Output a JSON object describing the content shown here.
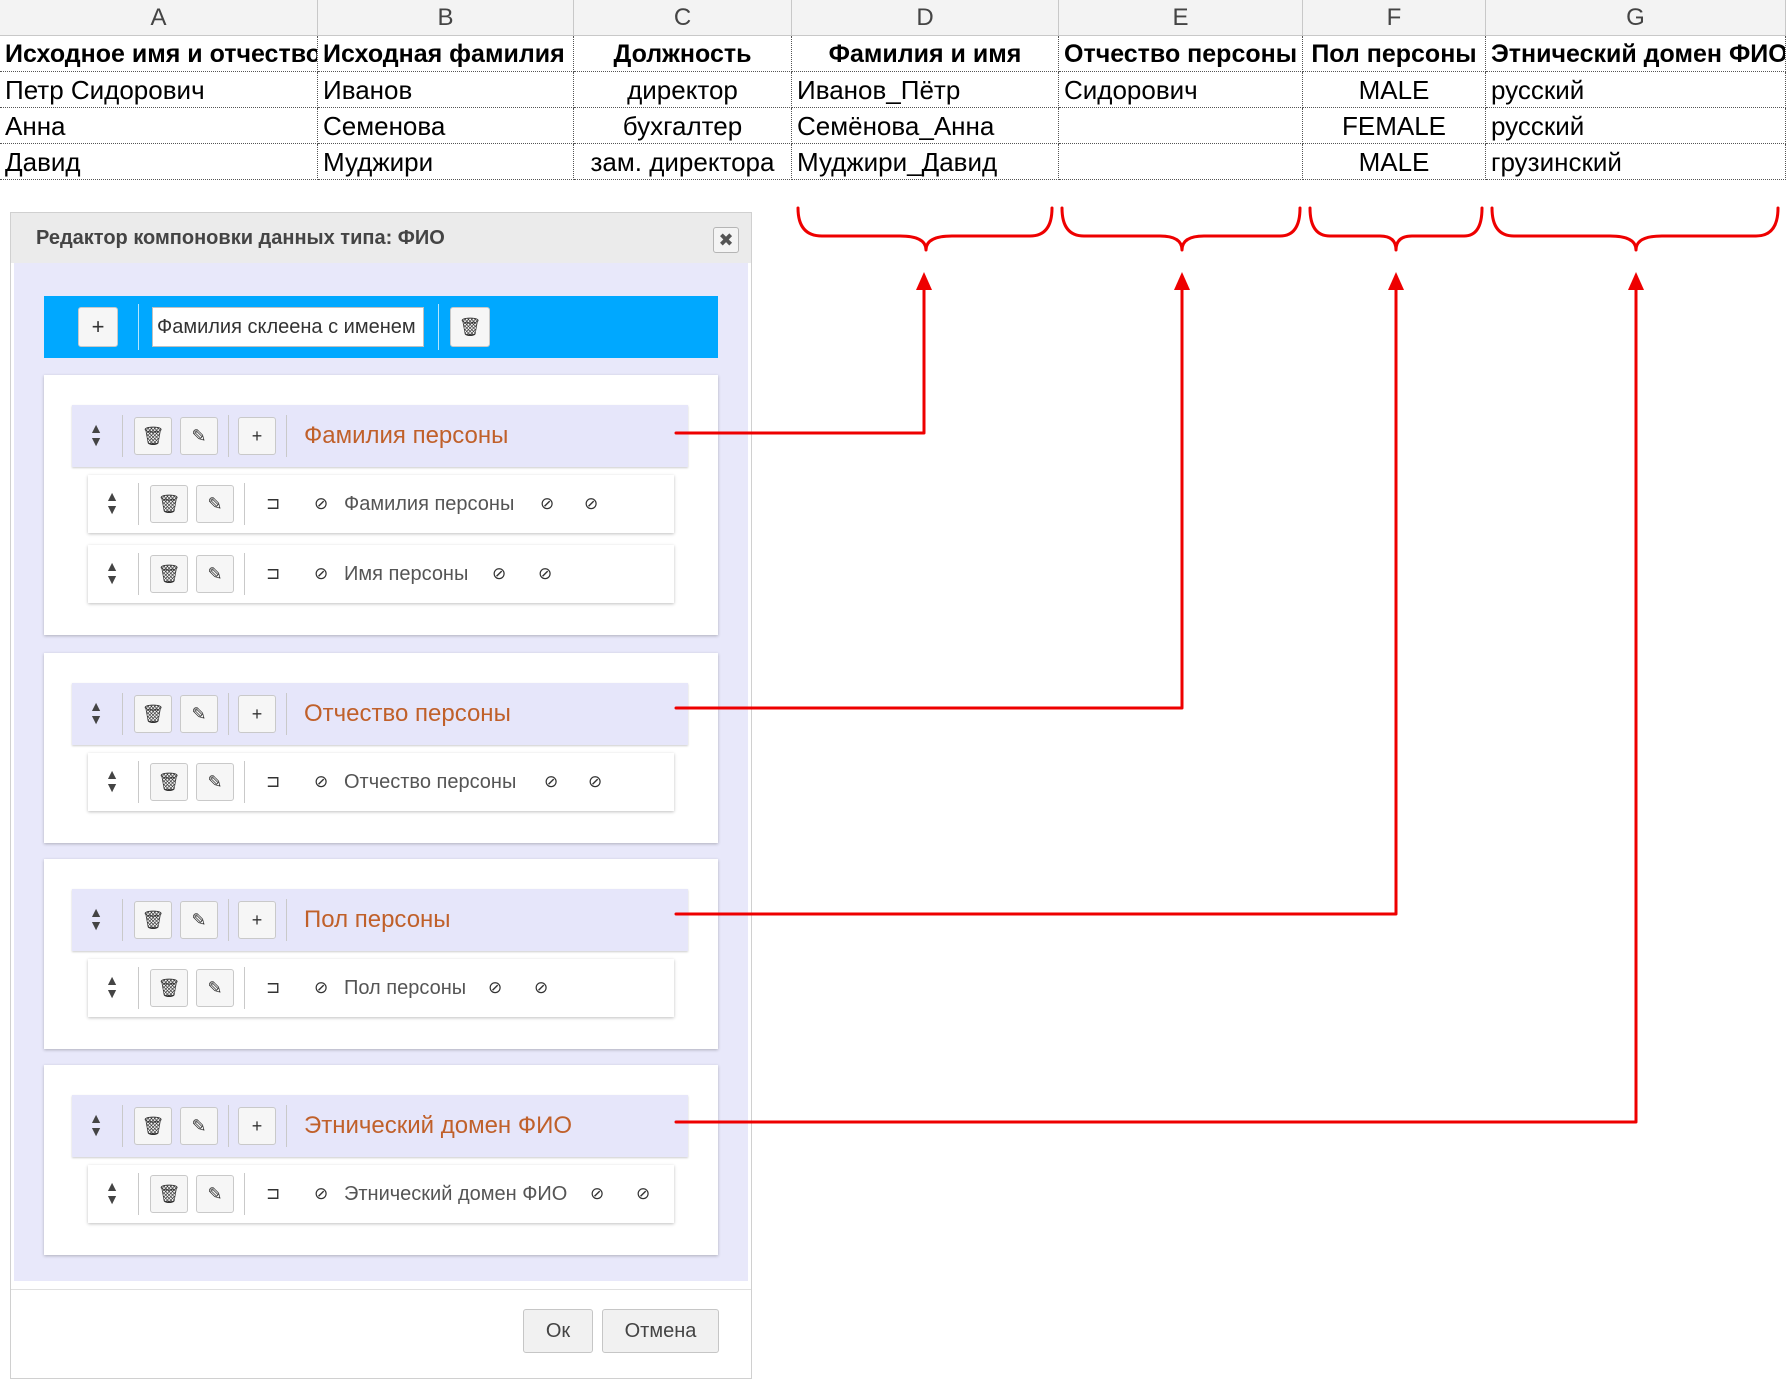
{
  "spreadsheet": {
    "column_letters": [
      "A",
      "B",
      "C",
      "D",
      "E",
      "F",
      "G"
    ],
    "header": [
      "Исходное имя и отчество",
      "Исходная фамилия",
      "Должность",
      "Фамилия и имя",
      "Отчество персоны",
      "Пол персоны",
      "Этнический домен ФИО"
    ],
    "rows": [
      [
        "Петр Сидорович",
        "Иванов",
        "директор",
        "Иванов_Пётр",
        "Сидорович",
        "MALE",
        "русский"
      ],
      [
        "Анна",
        "Семенова",
        "бухгалтер",
        "Семёнова_Анна",
        "",
        "FEMALE",
        "русский"
      ],
      [
        "Давид",
        "Муджири",
        "зам. директора",
        "Муджири_Давид",
        "",
        "MALE",
        "грузинский"
      ]
    ]
  },
  "dialog": {
    "title": "Редактор компоновки данных типа: ФИО",
    "close_label": "✖",
    "name_input_value": "Фамилия склеена с именем",
    "groups": [
      {
        "title": "Фамилия персоны",
        "items": [
          "Фамилия персоны",
          "Имя персоны"
        ]
      },
      {
        "title": "Отчество персоны",
        "items": [
          "Отчество персоны"
        ]
      },
      {
        "title": "Пол персоны",
        "items": [
          "Пол персоны"
        ]
      },
      {
        "title": "Этнический домен ФИО",
        "items": [
          "Этнический домен ФИО"
        ]
      }
    ],
    "ok_label": "Ок",
    "cancel_label": "Отмена"
  },
  "icons": {
    "add": "+",
    "delete": "🗑",
    "edit": "✎",
    "sort": "sort-icon",
    "lock": "unlock-icon",
    "ban": "⊘"
  },
  "colors": {
    "accent_bar": "#00a8ff",
    "group_title": "#c0602a",
    "connector": "#ee0000"
  }
}
